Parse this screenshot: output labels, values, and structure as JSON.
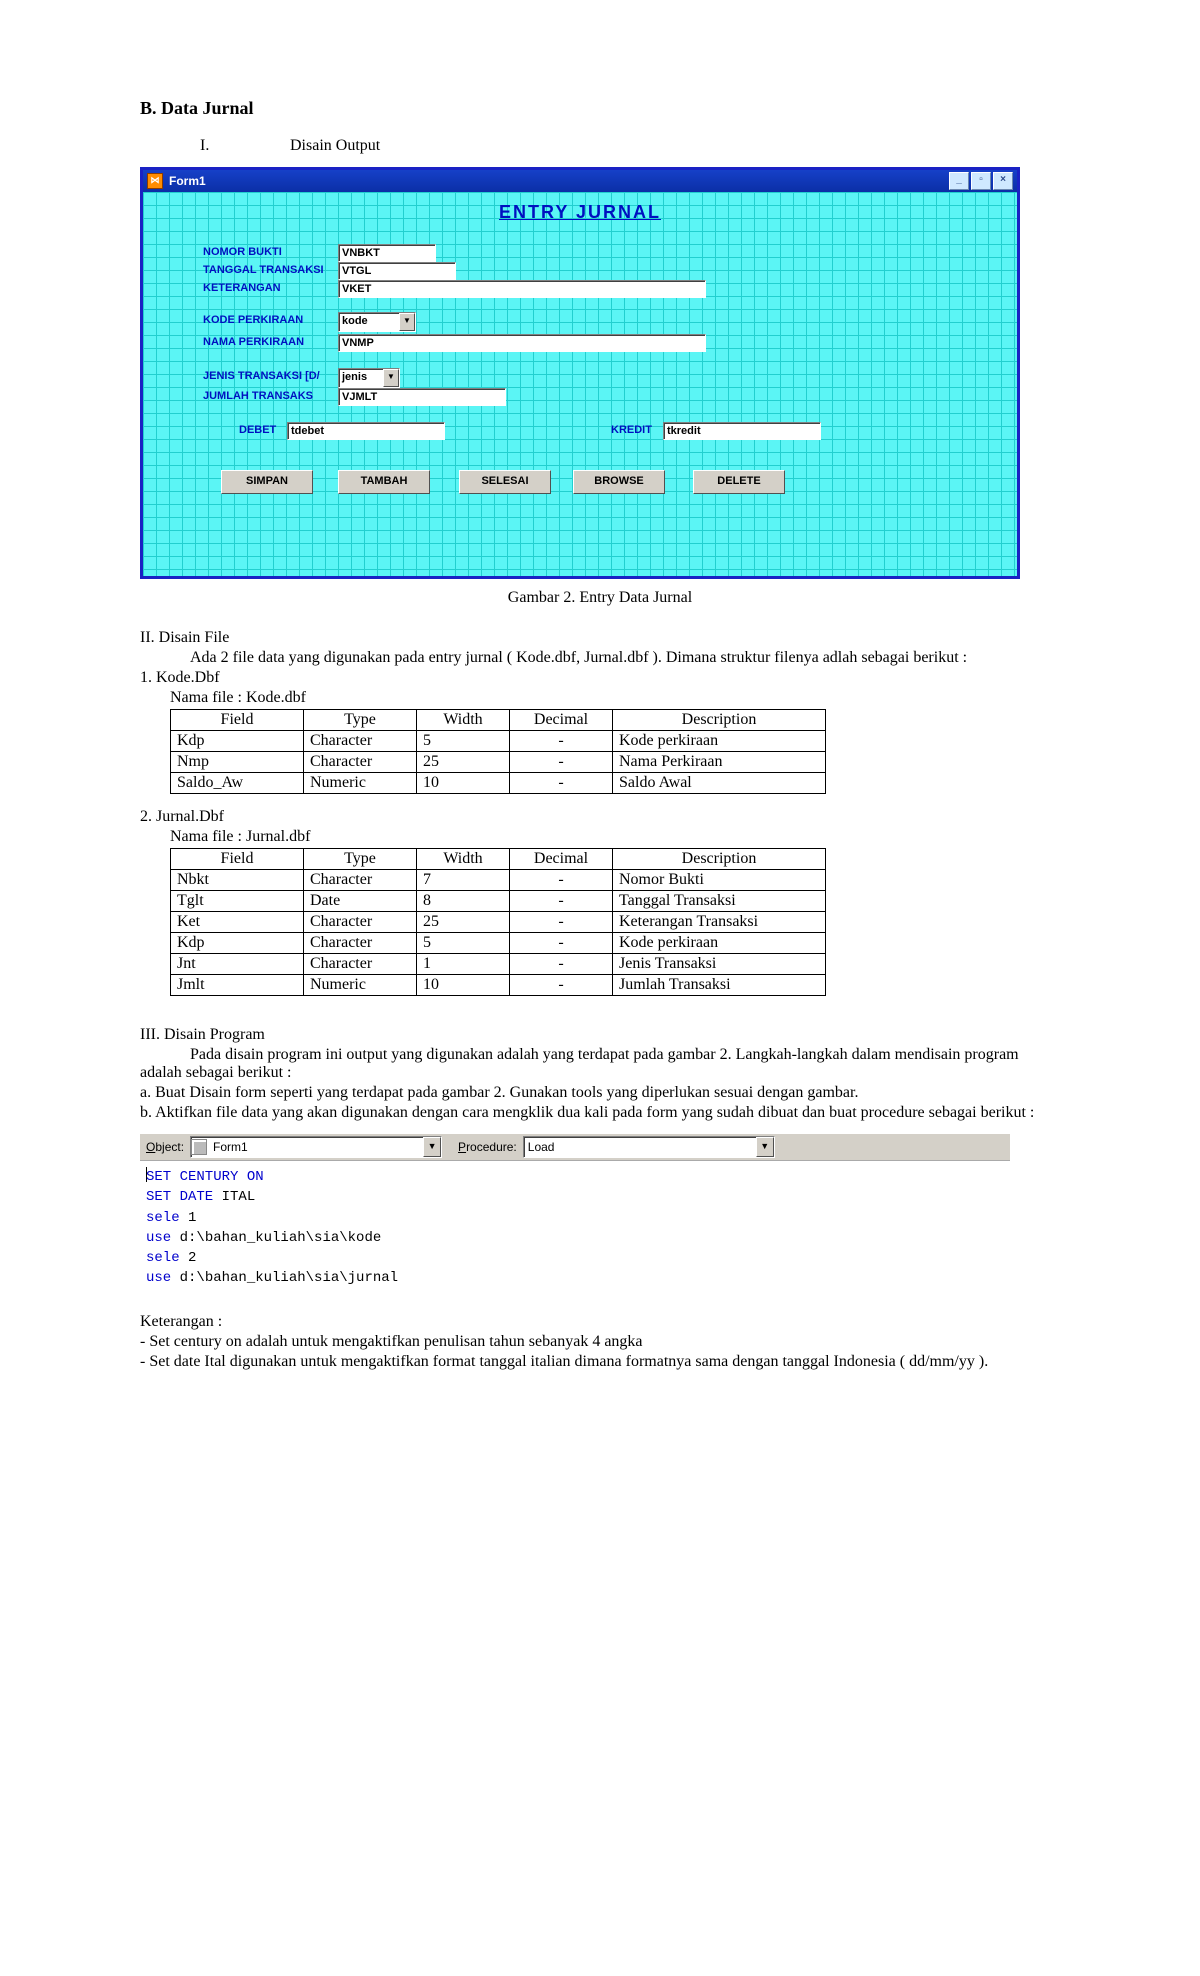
{
  "headings": {
    "section": "B. Data Jurnal",
    "sub1_num": "I.",
    "sub1": "Disain Output",
    "sub2": "II. Disain File",
    "sub3": "III. Disain Program"
  },
  "form": {
    "window_title": "Form1",
    "heading": "ENTRY JURNAL",
    "labels": {
      "nomor_bukti": "NOMOR BUKTI",
      "tanggal": "TANGGAL TRANSAKSI",
      "keterangan": "KETERANGAN",
      "kode_perk": "KODE PERKIRAAN",
      "nama_perk": "NAMA PERKIRAAN",
      "jenis": "JENIS TRANSAKSI [D/",
      "jumlah": "JUMLAH TRANSAKS",
      "debet": "DEBET",
      "kredit": "KREDIT"
    },
    "fields": {
      "nomor_bukti": "VNBKT",
      "tanggal": "VTGL",
      "keterangan": "VKET",
      "kode": "kode",
      "nama": "VNMP",
      "jenis": "jenis",
      "jumlah": "VJMLT",
      "debet": "tdebet",
      "kredit": "tkredit"
    },
    "buttons": {
      "simpan": "SIMPAN",
      "tambah": "TAMBAH",
      "selesai": "SELESAI",
      "browse": "BROWSE",
      "delete": "DELETE"
    }
  },
  "caption": "Gambar 2. Entry Data Jurnal",
  "body": {
    "p1": "Ada 2 file data yang digunakan pada entry jurnal ( Kode.dbf, Jurnal.dbf ). Dimana struktur filenya adlah sebagai berikut :",
    "t1_title": "1. Kode.Dbf",
    "t1_sub": "Nama file : Kode.dbf",
    "t2_title": "2. Jurnal.Dbf",
    "t2_sub": "Nama file : Jurnal.dbf"
  },
  "table_headers": {
    "field": "Field",
    "type": "Type",
    "width": "Width",
    "decimal": "Decimal",
    "desc": "Description"
  },
  "table1": [
    {
      "f": "Kdp",
      "t": "Character",
      "w": "5",
      "d": "-",
      "desc": "Kode perkiraan"
    },
    {
      "f": "Nmp",
      "t": "Character",
      "w": "25",
      "d": "-",
      "desc": "Nama Perkiraan"
    },
    {
      "f": "Saldo_Aw",
      "t": "Numeric",
      "w": "10",
      "d": "-",
      "desc": "Saldo Awal"
    }
  ],
  "table2": [
    {
      "f": "Nbkt",
      "t": "Character",
      "w": "7",
      "d": "-",
      "desc": "Nomor Bukti"
    },
    {
      "f": "Tglt",
      "t": "Date",
      "w": "8",
      "d": "-",
      "desc": "Tanggal Transaksi"
    },
    {
      "f": "Ket",
      "t": "Character",
      "w": "25",
      "d": "-",
      "desc": "Keterangan Transaksi"
    },
    {
      "f": "Kdp",
      "t": "Character",
      "w": "5",
      "d": "-",
      "desc": "Kode perkiraan"
    },
    {
      "f": "Jnt",
      "t": "Character",
      "w": "1",
      "d": "-",
      "desc": "Jenis Transaksi"
    },
    {
      "f": "Jmlt",
      "t": "Numeric",
      "w": "10",
      "d": "-",
      "desc": "Jumlah Transaksi"
    }
  ],
  "section3": {
    "p1": "Pada disain program ini output yang digunakan adalah yang terdapat pada gambar 2. Langkah-langkah dalam mendisain program adalah sebagai berikut :",
    "pa": "a. Buat Disain form seperti yang terdapat pada gambar 2. Gunakan tools yang diperlukan sesuai dengan gambar.",
    "pb": "b. Aktifkan file data yang akan digunakan dengan cara mengklik dua kali pada form yang sudah dibuat dan buat procedure sebagai berikut :",
    "ket_h": "Keterangan :",
    "ket1": "- Set century on adalah untuk mengaktifkan penulisan tahun sebanyak 4 angka",
    "ket2": "- Set date Ital digunakan untuk mengaktifkan format tanggal italian dimana formatnya sama dengan tanggal Indonesia ( dd/mm/yy )."
  },
  "editor": {
    "object_label": "Object:",
    "object_value": "Form1",
    "procedure_label": "Procedure:",
    "procedure_value": "Load",
    "code": {
      "l1a": "SET CENTURY ON",
      "l2a": "SET DATE",
      "l2b": " ITAL",
      "l3a": "sele",
      "l3b": " 1",
      "l4a": "use",
      "l4b": " d:\\bahan_kuliah\\sia\\kode",
      "l5a": "sele",
      "l5b": " 2",
      "l6a": "use",
      "l6b": " d:\\bahan_kuliah\\sia\\jurnal"
    }
  }
}
